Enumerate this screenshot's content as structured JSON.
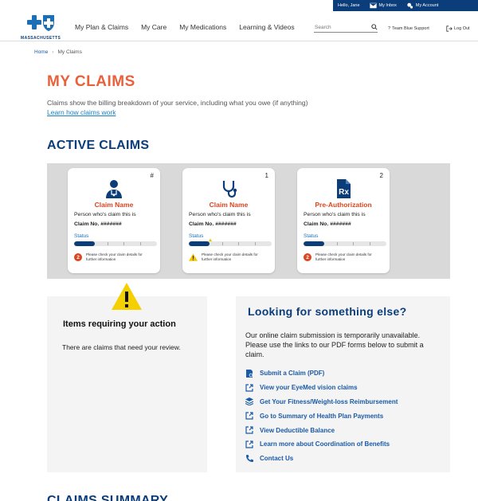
{
  "utility": {
    "hello": "Hello, Jane",
    "inbox": "My Inbox",
    "account": "My Account",
    "inbox_icon": "envelope-icon",
    "account_icon": "gear-icon"
  },
  "brand": {
    "name": "MASSACHUSETTS",
    "logo_icon": "blue-cross-shield-icon",
    "color": "#0b3d7a"
  },
  "nav": [
    "My Plan & Claims",
    "My Care",
    "My Medications",
    "Learning & Videos"
  ],
  "search": {
    "placeholder": "Search",
    "icon": "search-icon"
  },
  "header_links": {
    "support": "Team Blue Support",
    "support_icon": "question-icon",
    "logout": "Log Out",
    "logout_icon": "logout-icon"
  },
  "breadcrumb": {
    "home": "Home",
    "current": "My Claims"
  },
  "page": {
    "title": "MY CLAIMS",
    "intro": "Claims show the billing breakdown of your service, including what you owe (if anything)",
    "intro_link": "Learn how claims work",
    "title_color": "#e8613a"
  },
  "active_claims": {
    "title": "ACTIVE CLAIMS",
    "cards": [
      {
        "number": "#",
        "icon": "doctor-icon",
        "name": "Claim Name",
        "person": "Person who's claim this is",
        "claim_label": "Claim No.",
        "claim_value": "#######",
        "status_label": "Status",
        "progress": 0.25,
        "note_badge": "2",
        "note": "Please check your claim details for further information"
      },
      {
        "number": "1",
        "icon": "stethoscope-icon",
        "name": "Claim Name",
        "person": "Person who's claim this is",
        "claim_label": "Claim No.",
        "claim_value": "#######",
        "status_label": "Status",
        "progress": 0.25,
        "note_badge": "warning",
        "note": "Please check your claim details for further information"
      },
      {
        "number": "2",
        "icon": "prescription-icon",
        "name": "Pre-Authorization",
        "person": "Person who's claim this is",
        "claim_label": "Claim No.",
        "claim_value": "#######",
        "status_label": "Status",
        "progress": 0.25,
        "note_badge": "2",
        "note": "Please check your claim details for further information"
      }
    ]
  },
  "action": {
    "title": "Items requiring your action",
    "text": "There are claims that need your review.",
    "icon": "warning-icon"
  },
  "something_else": {
    "title": "Looking for something else?",
    "text": "Our online claim submission is temporarily unavailable. Please use the links to our PDF forms below to submit a claim.",
    "links": [
      {
        "label": "Submit a Claim (PDF)",
        "icon": "document-icon"
      },
      {
        "label": "View your EyeMed vision claims",
        "icon": "external-link-icon"
      },
      {
        "label": "Get Your Fitness/Weight-loss Reimbursement",
        "icon": "layers-icon"
      },
      {
        "label": "Go to Summary of Health Plan Payments",
        "icon": "external-link-icon"
      },
      {
        "label": "View Deductible Balance",
        "icon": "external-link-icon"
      },
      {
        "label": "Learn more about Coordination of Benefits",
        "icon": "external-link-icon"
      },
      {
        "label": "Contact Us",
        "icon": "phone-icon"
      }
    ]
  },
  "claims_summary": {
    "title": "CLAIMS SUMMARY"
  }
}
